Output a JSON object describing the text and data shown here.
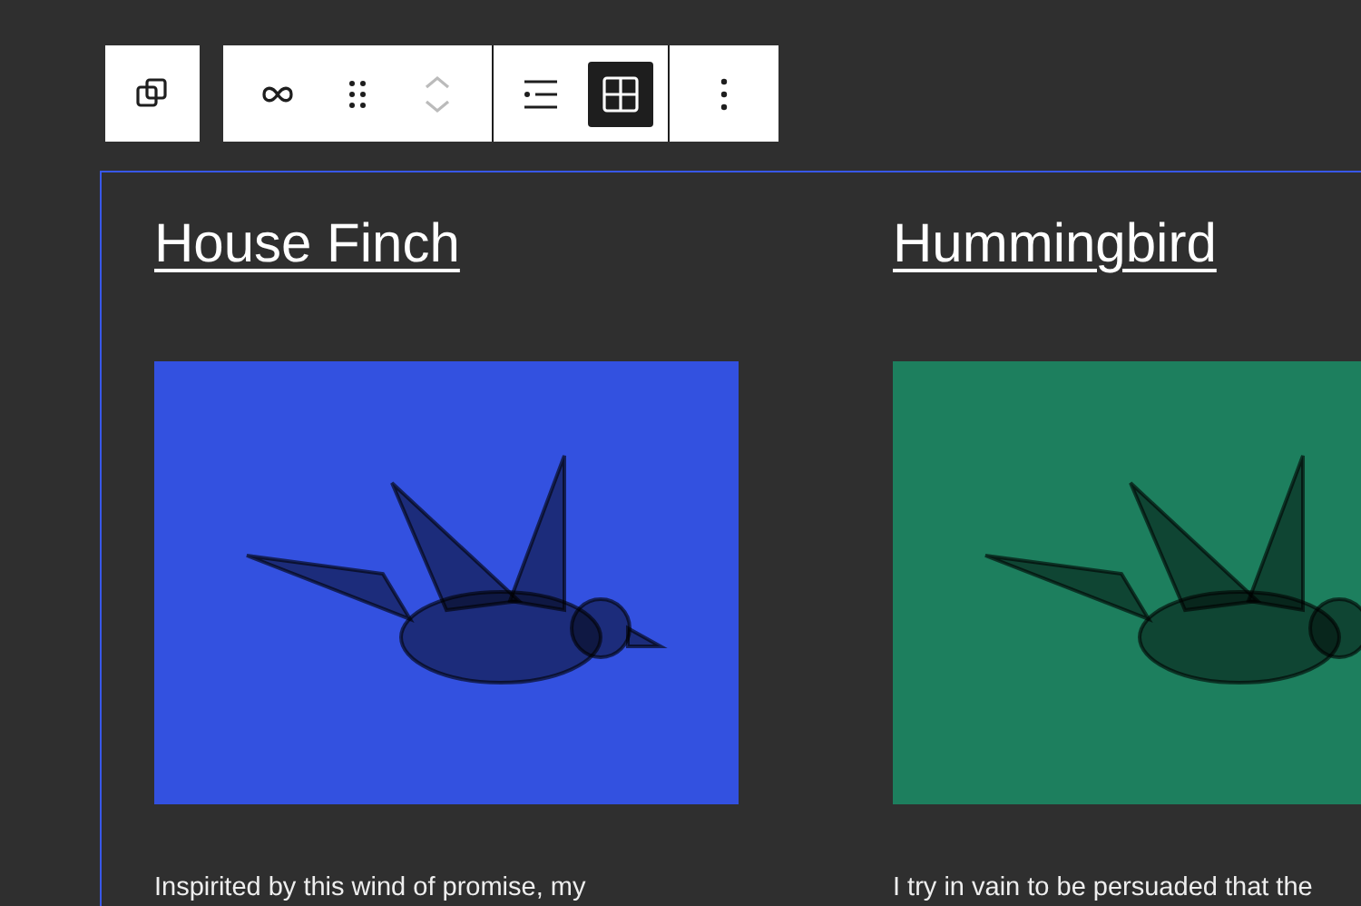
{
  "toolbar": {
    "groups": [
      {
        "buttons": [
          {
            "kind": "transform",
            "disabled": false,
            "selected": false
          }
        ]
      },
      {
        "buttons": [
          {
            "kind": "link",
            "disabled": false,
            "selected": false
          },
          {
            "kind": "drag",
            "disabled": false,
            "selected": false
          },
          {
            "kind": "mover",
            "disabled": true,
            "selected": false
          }
        ]
      },
      {
        "buttons": [
          {
            "kind": "list-view",
            "disabled": false,
            "selected": false
          },
          {
            "kind": "grid-view",
            "disabled": false,
            "selected": true
          }
        ]
      },
      {
        "buttons": [
          {
            "kind": "more",
            "disabled": false,
            "selected": false
          }
        ]
      }
    ]
  },
  "posts": [
    {
      "title": "House Finch",
      "color": "#3351e0",
      "excerpt": "Inspirited by this wind of promise, my"
    },
    {
      "title": "Hummingbird",
      "color": "#1d7f5e",
      "excerpt": "I try in vain to be persuaded that the"
    }
  ]
}
